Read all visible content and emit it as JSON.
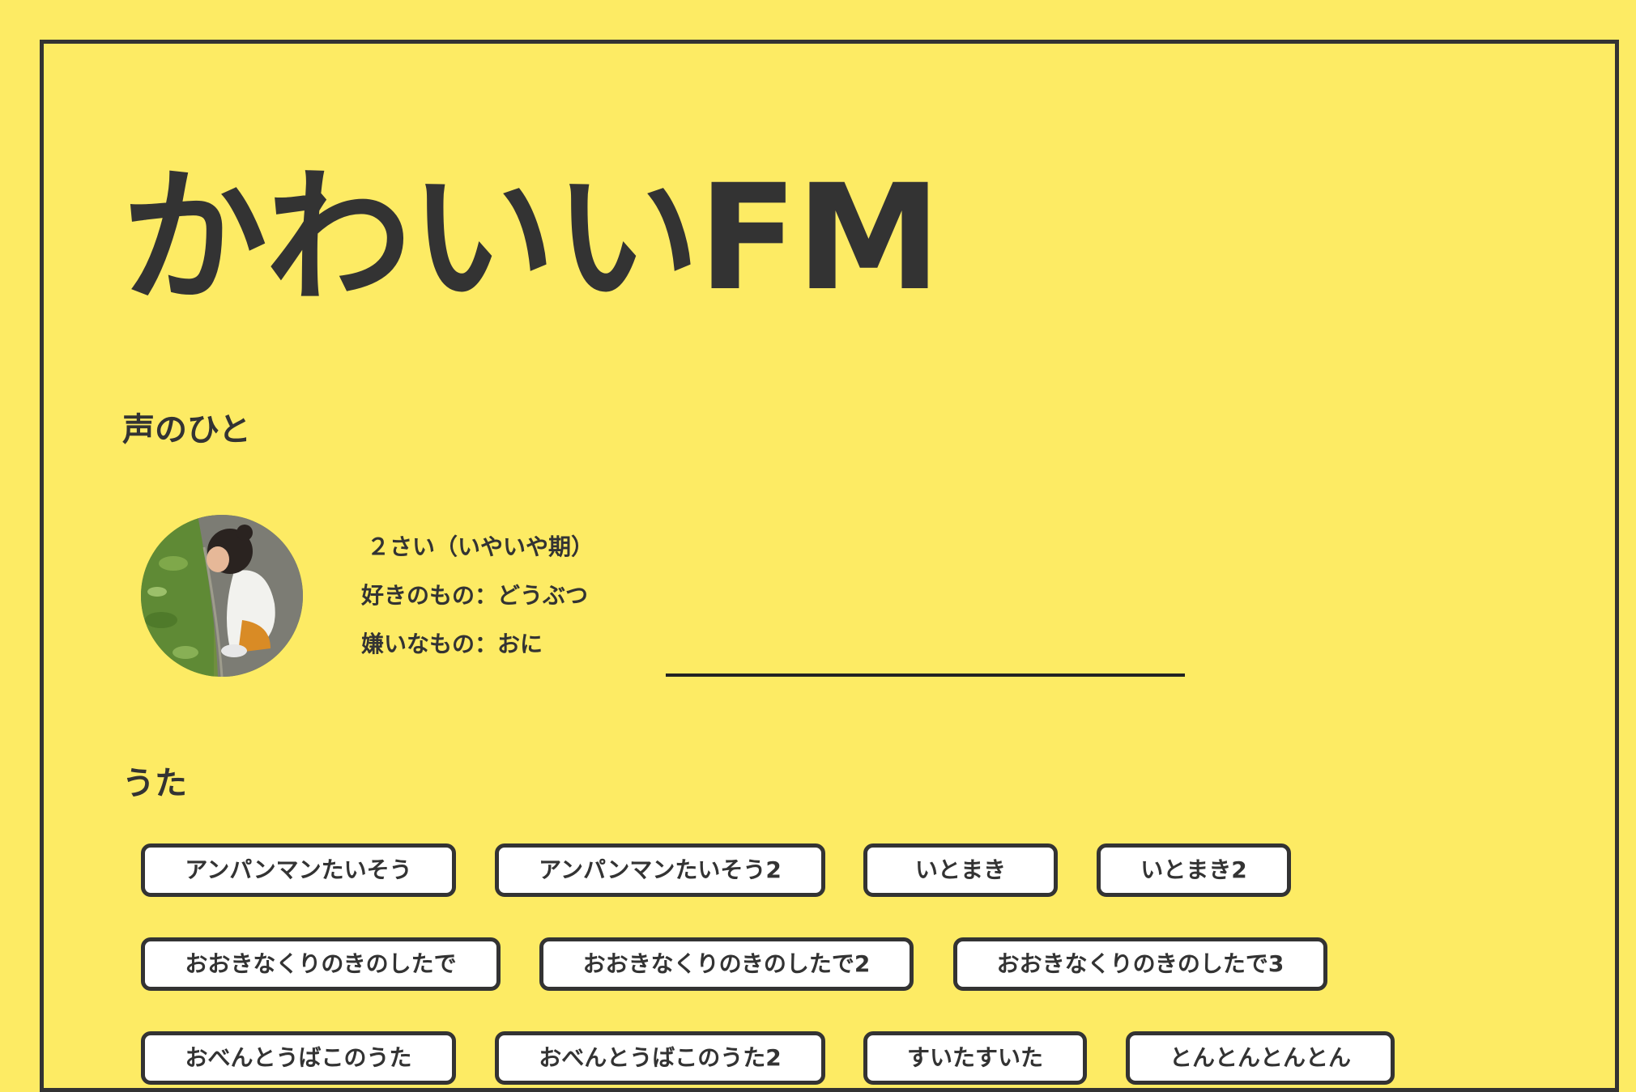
{
  "site": {
    "title": "かわいいFM"
  },
  "voice_section": {
    "heading": "声のひと",
    "profile": {
      "age": "２さい（いやいや期）",
      "likes": "好きのもの：どうぶつ",
      "dislikes": "嫌いなもの：おに"
    }
  },
  "songs_section": {
    "heading": "うた",
    "songs": [
      "アンパンマンたいそう",
      "アンパンマンたいそう2",
      "いとまき",
      "いとまき2",
      "おおきなくりのきのしたで",
      "おおきなくりのきのしたで2",
      "おおきなくりのきのしたで3",
      "おべんとうばこのうた",
      "おべんとうばこのうた2",
      "すいたすいた",
      "とんとんとんとん"
    ]
  },
  "colors": {
    "background": "#fdeb64",
    "ink": "#333333",
    "button_fill": "#ffffff"
  }
}
